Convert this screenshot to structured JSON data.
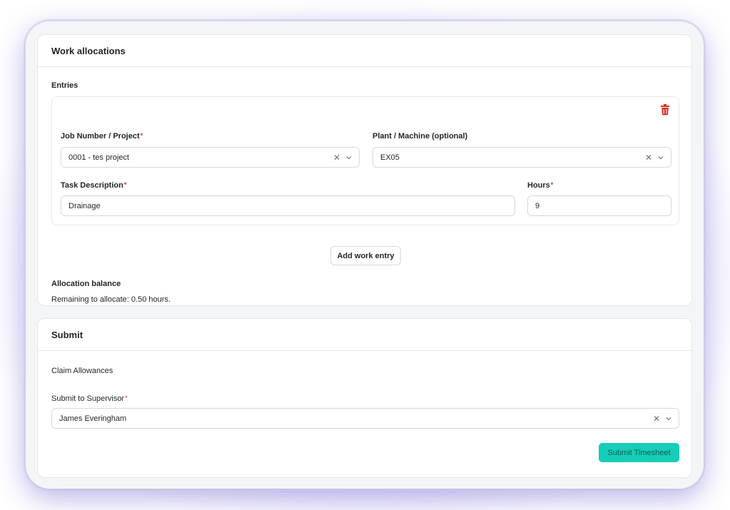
{
  "alloc": {
    "title": "Work allocations",
    "entries_label": "Entries",
    "entry": {
      "job_label": "Job Number / Project",
      "job_value": "0001 - tes project",
      "plant_label": "Plant / Machine (optional)",
      "plant_value": "EX05",
      "task_label": "Task Description",
      "task_value": "Drainage",
      "hours_label": "Hours",
      "hours_value": "9",
      "required_mark": "*"
    },
    "add_button": "Add work entry",
    "balance_label": "Allocation balance",
    "balance_text": "Remaining to allocate: 0.50 hours."
  },
  "submit": {
    "title": "Submit",
    "claim_label": "Claim Allowances",
    "supervisor_label": "Submit to Supervisor",
    "supervisor_value": "James Everingham",
    "submit_button": "Submit Timesheet"
  },
  "icons": {
    "delete": "trash-icon",
    "clear": "clear-x-icon",
    "dropdown": "chevron-down-icon"
  },
  "colors": {
    "accent": "#17cdb8",
    "danger": "#d92d20"
  }
}
